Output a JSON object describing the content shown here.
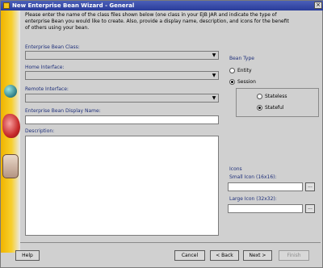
{
  "window": {
    "title": "New Enterprise Bean Wizard - General",
    "close_label": "×"
  },
  "intro_text": "Please enter the name of the class files shown below (one class in your EJB JAR and indicate the type of enterprise Bean you would like to create. Also, provide a display name, description, and icons for the benefit of others using your bean.",
  "fields": {
    "bean_class_label": "Enterprise Bean Class:",
    "home_interface_label": "Home Interface:",
    "remote_interface_label": "Remote Interface:",
    "display_name_label": "Enterprise Bean Display Name:",
    "description_label": "Description:",
    "combo_arrow": "▼",
    "bean_class_value": "",
    "home_interface_value": "",
    "remote_interface_value": "",
    "display_name_value": "",
    "description_value": ""
  },
  "bean_type": {
    "label": "Bean Type",
    "options": [
      "Entity",
      "Session"
    ],
    "selected": "Session",
    "session_options": [
      "Stateless",
      "Stateful"
    ],
    "session_selected": "Stateful"
  },
  "icons": {
    "label": "Icons",
    "small_icon_label": "Small Icon (16x16):",
    "large_icon_label": "Large Icon (32x32):",
    "browse_label": "...",
    "small_icon_value": "",
    "large_icon_value": ""
  },
  "buttons": {
    "help": "Help",
    "cancel": "Cancel",
    "back": "< Back",
    "next": "Next >",
    "finish": "Finish"
  }
}
